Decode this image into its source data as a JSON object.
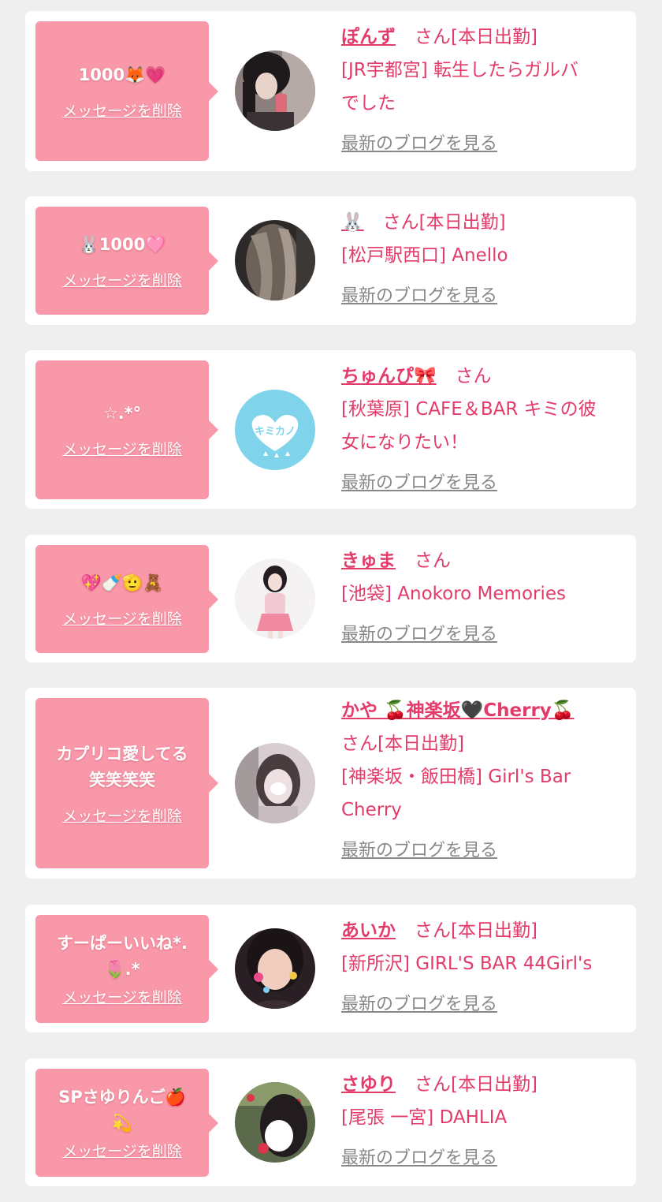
{
  "delete_label": "メッセージを削除",
  "blog_label": "最新のブログを見る",
  "san_label": "さん",
  "status_label": "[本日出勤]",
  "colors": {
    "background": "#efefef",
    "card": "#ffffff",
    "bubble": "#f898a8",
    "accent_text": "#e33b6a",
    "link_gray": "#888888"
  },
  "messages": [
    {
      "message": "1000🦊💗",
      "name": "ぽんず",
      "status": "[本日出勤]",
      "shop_line1": "[JR宇都宮] 転生したらガルバ",
      "shop_line2": "でした",
      "avatar_icon": "photo-avatar-dark-hair"
    },
    {
      "message": "🐰1000🩷",
      "name": "🐰",
      "status": "[本日出勤]",
      "shop_line1": "[松戸駅西口] Anello",
      "shop_line2": "",
      "avatar_icon": "photo-avatar-long-hair"
    },
    {
      "message": "☆.*°",
      "name": "ちゅんぴ🎀",
      "status": "",
      "shop_line1": "[秋葉原] CAFE＆BAR キミの彼",
      "shop_line2": "女になりたい！",
      "avatar_icon": "kimikano-logo-avatar",
      "avatar_text": "キミカノ"
    },
    {
      "message": "💖🍼🫡🧸",
      "name": "きゅま",
      "status": "",
      "shop_line1": "[池袋] Anokoro Memories",
      "shop_line2": "",
      "avatar_icon": "photo-avatar-pink-outfit"
    },
    {
      "message_line1": "カプリコ愛してる",
      "message_line2": "笑笑笑笑",
      "name": "かや 🍒神楽坂🖤Cherry🍒",
      "status": "[本日出勤]",
      "shop_line1": "[神楽坂・飯田橋] Girl's Bar",
      "shop_line2": "Cherry",
      "avatar_icon": "photo-avatar-blurred"
    },
    {
      "message_line1": "すーぱーいいね*.",
      "message_line2": "🌷.*",
      "name": "あいか",
      "status": "[本日出勤]",
      "shop_line1": "[新所沢] GIRL'S BAR 44Girl's",
      "shop_line2": "",
      "avatar_icon": "photo-avatar-stickers"
    },
    {
      "message_line1": "SPさゆりんご🍎",
      "message_line2": "💫",
      "name": "さゆり",
      "status": "[本日出勤]",
      "shop_line1": "[尾張 一宮] DAHLIA",
      "shop_line2": "",
      "avatar_icon": "photo-avatar-strawberry"
    }
  ]
}
